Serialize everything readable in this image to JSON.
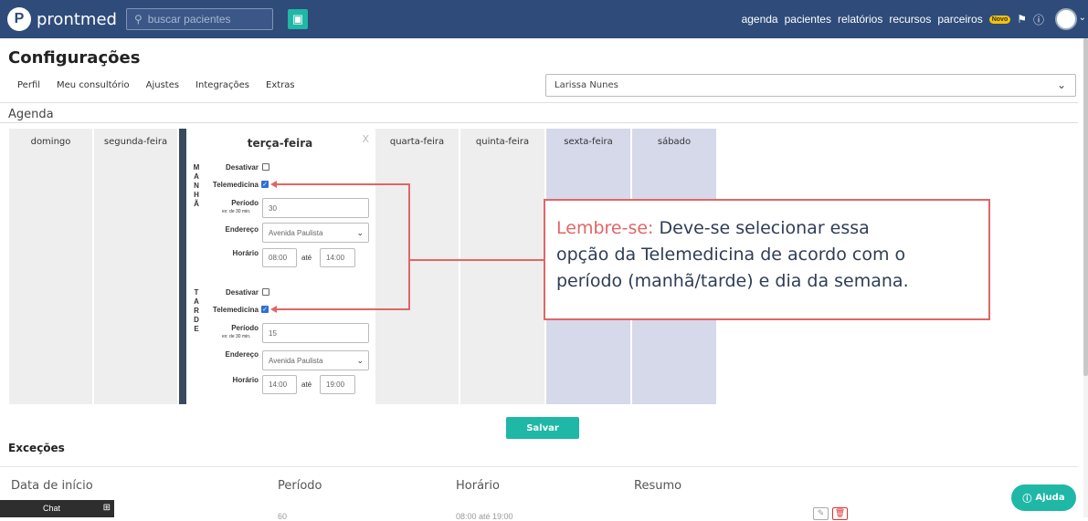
{
  "app": {
    "logo_text": "prontmed"
  },
  "topbar": {
    "search_placeholder": "buscar pacientes",
    "nav": [
      "agenda",
      "pacientes",
      "relatórios",
      "recursos",
      "parceiros"
    ],
    "novo_badge": "Novo"
  },
  "page": {
    "title": "Configurações"
  },
  "tabs": [
    "Perfil",
    "Meu consultório",
    "Ajustes",
    "Integrações",
    "Extras"
  ],
  "professional_select": {
    "value": "Larissa Nunes"
  },
  "agenda": {
    "section_title": "Agenda",
    "days": [
      "domingo",
      "segunda-feira",
      "terça-feira",
      "quarta-feira",
      "quinta-feira",
      "sexta-feira",
      "sábado"
    ],
    "close_label": "X",
    "labels": {
      "desativar": "Desativar",
      "telemedicina": "Telemedicina",
      "periodo": "Período",
      "periodo_hint": "ex: de 30 min.",
      "endereco": "Endereço",
      "horario": "Horário",
      "ate": "até"
    },
    "manha": {
      "letters": [
        "M",
        "A",
        "N",
        "H",
        "Ã"
      ],
      "desativar_checked": false,
      "telemedicina_checked": true,
      "periodo": "30",
      "endereco": "Avenida Paulista",
      "horario_inicio": "08:00",
      "horario_fim": "14:00"
    },
    "tarde": {
      "letters": [
        "T",
        "A",
        "R",
        "D",
        "E"
      ],
      "desativar_checked": false,
      "telemedicina_checked": true,
      "periodo": "15",
      "endereco": "Avenida Paulista",
      "horario_inicio": "14:00",
      "horario_fim": "19:00"
    },
    "save_label": "Salvar"
  },
  "annotation": {
    "lead": "Lembre-se:",
    "line1": "Deve-se selecionar essa",
    "line2": "opção da Telemedicina de acordo com o",
    "line3": "período (manhã/tarde) e dia da semana.",
    "color": "#e06666"
  },
  "excecoes": {
    "title": "Exceções",
    "columns": [
      "Data de início",
      "Período",
      "Horário",
      "Resumo"
    ],
    "row": {
      "periodo": "60",
      "horario": "08:00 até 19:00"
    }
  },
  "chat": {
    "label": "Chat"
  },
  "help": {
    "label": "Ajuda"
  },
  "colors": {
    "topbar": "#2e4b7a",
    "accent": "#1fb7a6",
    "highlight_day": "#d6d9ea"
  }
}
